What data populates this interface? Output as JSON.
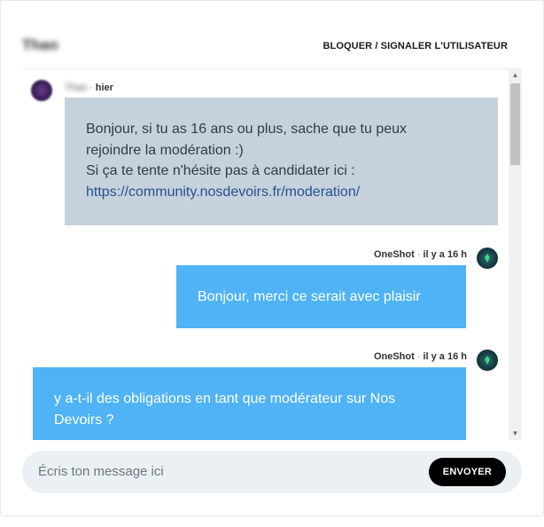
{
  "header": {
    "username": "Thao",
    "report_label": "BLOQUER / SIGNALER L'UTILISATEUR"
  },
  "messages": [
    {
      "author": "Thao",
      "time": "hier",
      "lines": [
        "Bonjour, si tu as 16 ans ou plus, sache que tu peux",
        "rejoindre la modération :)",
        "Si ça te tente n'hésite pas à candidater ici :"
      ],
      "link": "https://community.nosdevoirs.fr/moderation/"
    },
    {
      "author": "OneShot",
      "time": "il y a 16 h",
      "text": "Bonjour, merci ce serait avec plaisir"
    },
    {
      "author": "OneShot",
      "time": "il y a 16 h",
      "text": "y a-t-il des obligations en tant que modérateur sur Nos Devoirs ?"
    }
  ],
  "meta_separator": "·",
  "composer": {
    "placeholder": "Écris ton message ici",
    "send_label": "ENVOYER"
  },
  "scrollbar": {
    "up_icon": "▲",
    "down_icon": "▼"
  },
  "colors": {
    "received_bubble": "#c5d1dc",
    "sent_bubble": "#4fb3f6",
    "send_button": "#000000",
    "link": "#27538b"
  }
}
